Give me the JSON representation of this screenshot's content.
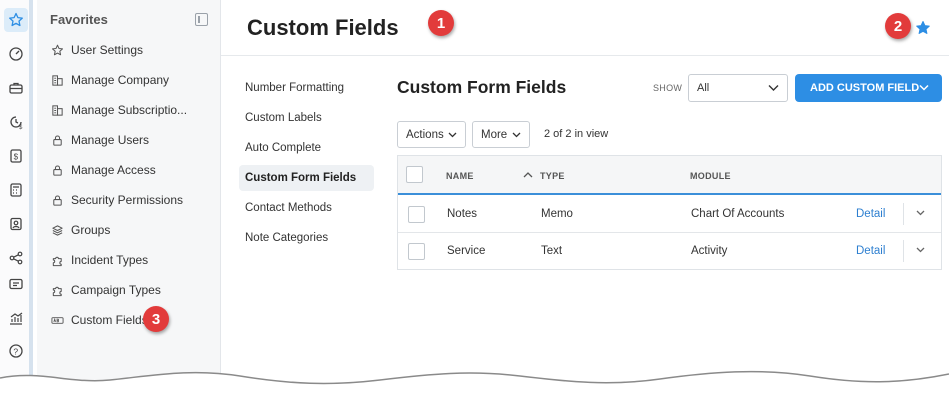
{
  "rail": {
    "icons": [
      "star-icon",
      "dashboard-gauge-icon",
      "briefcase-icon",
      "clock-dollar-icon",
      "dollar-document-icon",
      "calculator-icon",
      "contact-badge-icon",
      "share-nodes-icon",
      "id-card-icon",
      "analytics-chart-icon",
      "help-icon"
    ]
  },
  "favorites": {
    "title": "Favorites",
    "items": [
      {
        "label": "User Settings",
        "icon": "star-outline-icon"
      },
      {
        "label": "Manage Company",
        "icon": "building-icon"
      },
      {
        "label": "Manage Subscriptio...",
        "icon": "building-icon"
      },
      {
        "label": "Manage Users",
        "icon": "lock-icon"
      },
      {
        "label": "Manage Access",
        "icon": "lock-icon"
      },
      {
        "label": "Security Permissions",
        "icon": "lock-icon"
      },
      {
        "label": "Groups",
        "icon": "layers-icon"
      },
      {
        "label": "Incident Types",
        "icon": "puzzle-icon"
      },
      {
        "label": "Campaign Types",
        "icon": "puzzle-icon"
      },
      {
        "label": "Custom Fields",
        "icon": "fields-tag-icon"
      }
    ]
  },
  "header": {
    "title": "Custom Fields",
    "favorite_icon": "star-filled-icon",
    "accent": "#2d8ee4"
  },
  "markers": [
    "1",
    "2",
    "3"
  ],
  "subnav": {
    "items": [
      {
        "label": "Number Formatting"
      },
      {
        "label": "Custom Labels"
      },
      {
        "label": "Auto Complete"
      },
      {
        "label": "Custom Form Fields"
      },
      {
        "label": "Contact Methods"
      },
      {
        "label": "Note Categories"
      }
    ],
    "active_index": 3
  },
  "section": {
    "title": "Custom Form Fields",
    "show_label": "SHOW",
    "show_value": "All",
    "add_button": "ADD CUSTOM FIELD"
  },
  "toolbar": {
    "actions_label": "Actions",
    "more_label": "More",
    "view_count": "2 of 2 in view"
  },
  "table": {
    "columns": [
      "NAME",
      "TYPE",
      "MODULE"
    ],
    "rows": [
      {
        "name": "Notes",
        "type": "Memo",
        "module": "Chart Of Accounts",
        "action": "Detail"
      },
      {
        "name": "Service",
        "type": "Text",
        "module": "Activity",
        "action": "Detail"
      }
    ]
  }
}
